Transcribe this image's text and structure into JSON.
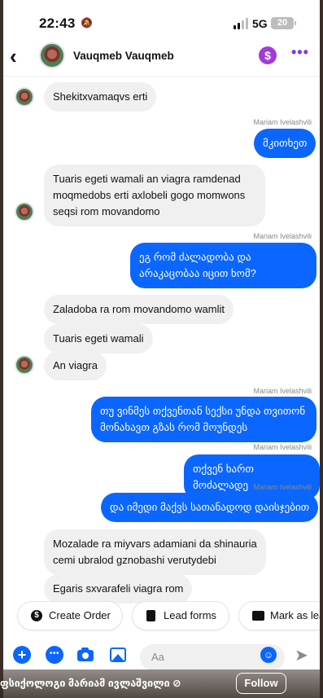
{
  "status": {
    "time": "22:43",
    "network": "5G",
    "battery": "20"
  },
  "header": {
    "contact_name": "Vauqmeb Vauqmeb",
    "back_label": "‹",
    "dollar_label": "$",
    "more_label": "•••"
  },
  "messages": [
    {
      "text": "Shekitxvamaqvs erti"
    },
    {
      "sender": "Mariam Ivelashvili",
      "text": "მკითხეთ"
    },
    {
      "text": "Tuaris egeti wamali an viagra ramdenad moqmedobs erti axlobeli gogo momwons seqsi rom movandomo"
    },
    {
      "sender": "Mariam Ivelashvili",
      "text": "ეგ რომ ძალადობა და არაკაცობაა იცით ხომ?"
    },
    {
      "text": "Zaladoba ra rom movandomo wamlit"
    },
    {
      "text": "Tuaris egeti wamali"
    },
    {
      "text": "An viagra"
    },
    {
      "sender": "Mariam Ivelashvili",
      "text": "თუ ვინმეს თქვენთან სექსი უნდა თვითონ მონახავთ გზას რომ მოუნდეს"
    },
    {
      "sender": "Mariam Ivelashvili",
      "text": "თქვენ ხართ მოძალადე"
    },
    {
      "sender": "Mariam Ivelashvili",
      "text": "და იმედი მაქვს სათანადოდ დაისჯებით"
    },
    {
      "text": "Mozalade ra miyvars adamiani da shinauria cemi ubralod gznobashi verutydebi"
    },
    {
      "text": "Egaris sxvarafeli viagra rom"
    }
  ],
  "actions": [
    {
      "label": "Create Order",
      "icon": "dollar-circle-icon"
    },
    {
      "label": "Lead forms",
      "icon": "form-icon"
    },
    {
      "label": "Mark as lea",
      "icon": "tag-card-icon"
    }
  ],
  "composer": {
    "placeholder": "Aa"
  },
  "overlay": {
    "caption": "ფსიქოლოგი მარიამ ივლაშვილი ⊘",
    "follow_label": "Follow"
  },
  "colors": {
    "accent": "#0a66ff",
    "outgoing_bubble": "#0a66ff",
    "incoming_bubble": "#f0f0f0",
    "dollar_badge": "#a33bd8"
  }
}
